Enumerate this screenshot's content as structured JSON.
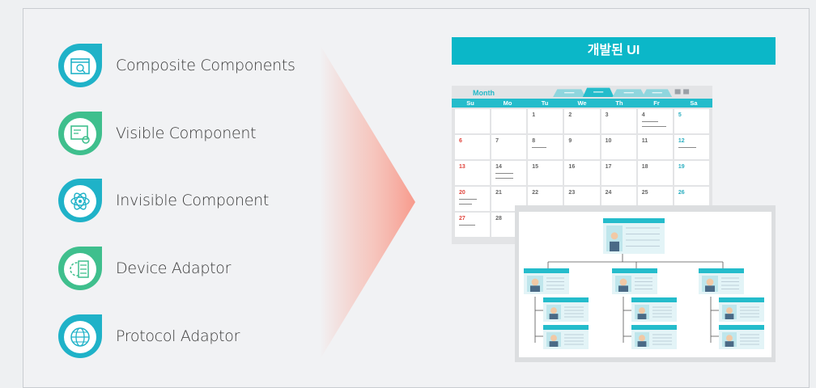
{
  "items": [
    {
      "label": "Composite Components",
      "icon": "window-search-icon",
      "color": "#1fb2c8"
    },
    {
      "label": "Visible Component",
      "icon": "dashboard-settings-icon",
      "color": "#3fbf8d"
    },
    {
      "label": "Invisible Component",
      "icon": "atom-icon",
      "color": "#1fb2c8"
    },
    {
      "label": "Device Adaptor",
      "icon": "server-gear-icon",
      "color": "#3fbf8d"
    },
    {
      "label": "Protocol Adaptor",
      "icon": "globe-icon",
      "color": "#1fb2c8"
    }
  ],
  "result": {
    "title": "개발된 UI"
  },
  "calendar": {
    "month": "Month",
    "days": [
      "Su",
      "Mo",
      "Tu",
      "We",
      "Th",
      "Fr",
      "Sa"
    ],
    "cells": [
      "",
      "",
      "1",
      "2",
      "3",
      "4",
      "5",
      "6",
      "7",
      "8",
      "9",
      "10",
      "11",
      "12",
      "13",
      "14",
      "15",
      "16",
      "17",
      "18",
      "19",
      "20",
      "21",
      "22",
      "23",
      "24",
      "25",
      "26",
      "27",
      "28"
    ]
  },
  "colors": {
    "teal": "#0bb7c8",
    "green": "#3fbf8d",
    "arrow": "#f7a89c"
  }
}
